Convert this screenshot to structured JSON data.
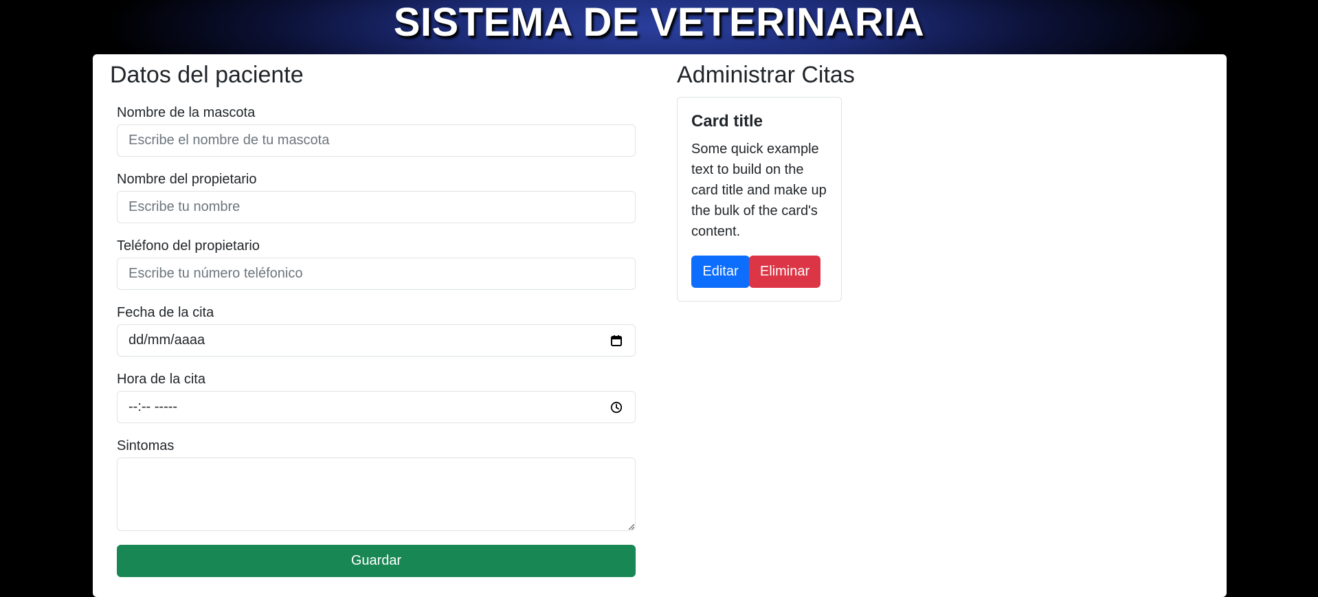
{
  "header": {
    "title": "SISTEMA DE VETERINARIA"
  },
  "form": {
    "title": "Datos del paciente",
    "fields": [
      {
        "label": "Nombre de la mascota",
        "placeholder": "Escribe el nombre de tu mascota"
      },
      {
        "label": "Nombre del propietario",
        "placeholder": "Escribe tu nombre"
      },
      {
        "label": "Teléfono del propietario",
        "placeholder": "Escribe tu número teléfonico"
      },
      {
        "label": "Fecha de la cita",
        "value": "dd/mm/aaaa",
        "icon": "calendar-icon"
      },
      {
        "label": "Hora de la cita",
        "value": "--:-- -----",
        "icon": "clock-icon"
      },
      {
        "label": "Sintomas"
      }
    ],
    "submit_label": "Guardar"
  },
  "citas": {
    "title": "Administrar Citas",
    "card": {
      "title": "Card title",
      "text": "Some quick example text to build on the card title and make up the bulk of the card's content.",
      "edit_label": "Editar",
      "delete_label": "Eliminar"
    }
  },
  "colors": {
    "page_background": "#000000",
    "header_accent": "#2a3f9c",
    "save_button": "#198754",
    "edit_button": "#0d6efd",
    "delete_button": "#dc3545"
  }
}
